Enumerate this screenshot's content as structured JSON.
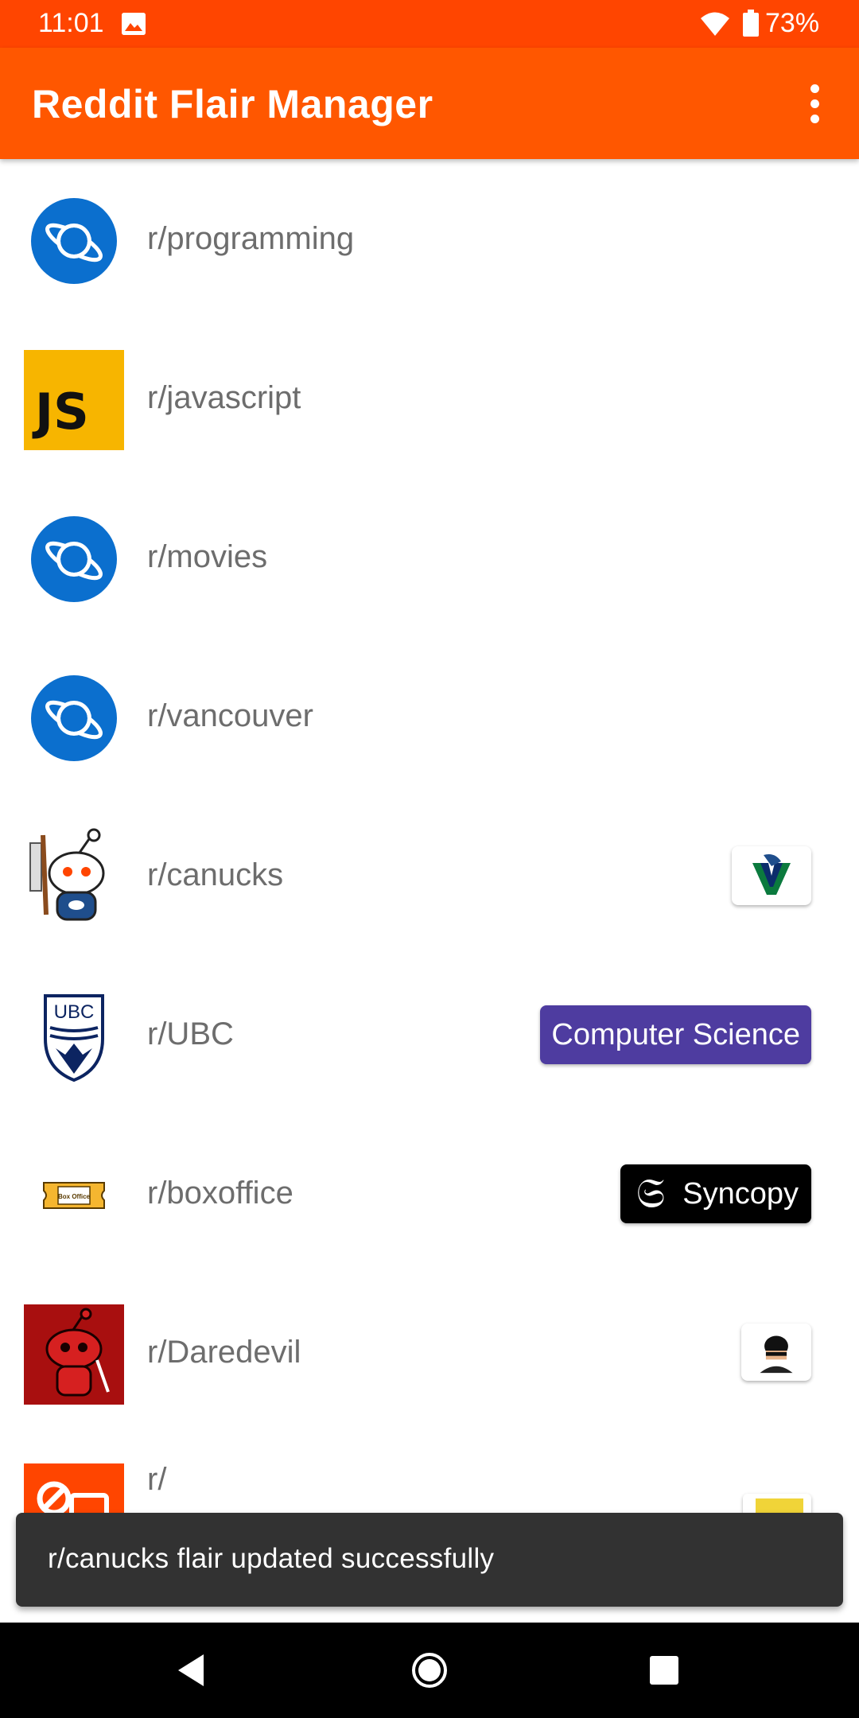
{
  "status_bar": {
    "time": "11:01",
    "battery": "73%",
    "icons": [
      "gallery-icon",
      "wifi-icon",
      "battery-icon"
    ]
  },
  "app_bar": {
    "title": "Reddit Flair Manager",
    "menu_icon": "overflow-menu-icon"
  },
  "subreddits": [
    {
      "name": "r/programming",
      "icon": "planet-icon",
      "flair": null
    },
    {
      "name": "r/javascript",
      "icon": "js-logo-icon",
      "icon_text": "JS",
      "flair": null
    },
    {
      "name": "r/movies",
      "icon": "planet-icon",
      "flair": null
    },
    {
      "name": "r/vancouver",
      "icon": "planet-icon",
      "flair": null
    },
    {
      "name": "r/canucks",
      "icon": "snoo-mascot-icon",
      "flair": {
        "type": "image",
        "icon": "canucks-logo-icon"
      }
    },
    {
      "name": "r/UBC",
      "icon": "ubc-crest-icon",
      "icon_text": "UBC",
      "flair": {
        "type": "text",
        "text": "Computer Science",
        "color": "#4e3ca0"
      }
    },
    {
      "name": "r/boxoffice",
      "icon": "box-office-ticket-icon",
      "icon_text": "Box Office",
      "flair": {
        "type": "text",
        "text": "Syncopy",
        "color": "#000000",
        "icon": "syncopy-logo-icon"
      }
    },
    {
      "name": "r/Daredevil",
      "icon": "daredevil-snoo-icon",
      "flair": {
        "type": "image",
        "icon": "character-avatar-icon"
      }
    },
    {
      "name": "r/",
      "icon": "orange-subreddit-icon",
      "flair": {
        "type": "image",
        "icon": "yellow-flair-icon"
      }
    }
  ],
  "snackbar": {
    "message": "r/canucks flair updated successfully"
  },
  "nav_bar": {
    "buttons": [
      "back-icon",
      "home-icon",
      "recents-icon"
    ]
  },
  "colors": {
    "status_bar": "#ff4500",
    "app_bar": "#ff5700",
    "planet_blue": "#0b6fce",
    "js_yellow": "#f7b500",
    "ubc_flair": "#4e3ca0"
  }
}
